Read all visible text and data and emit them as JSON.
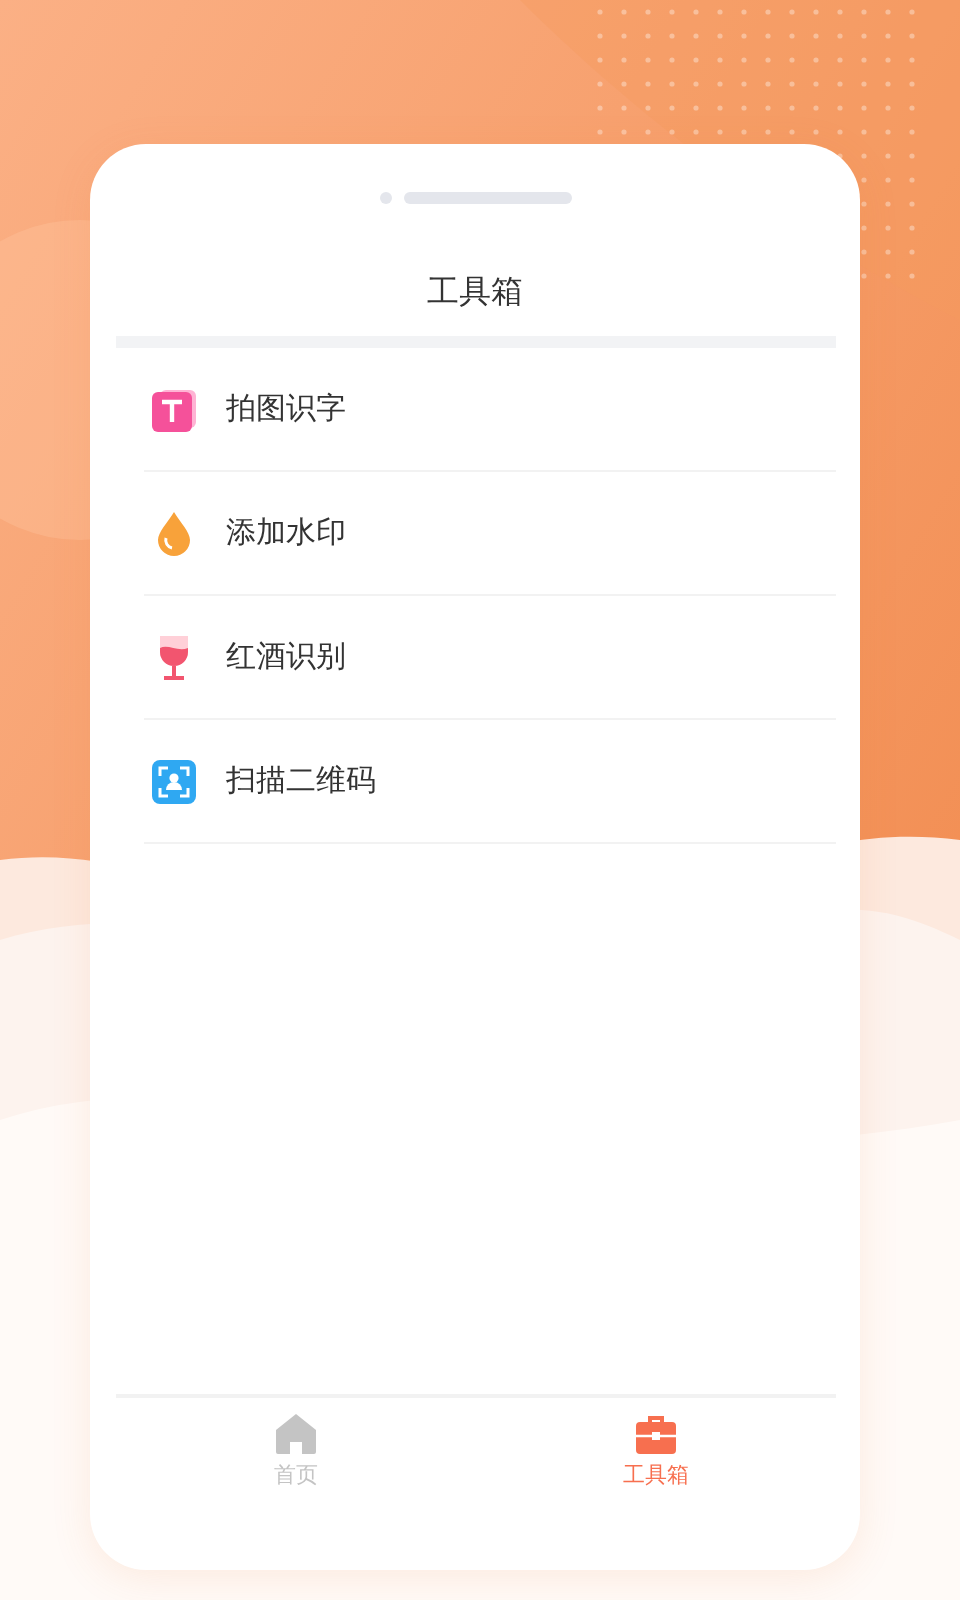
{
  "title": "工具箱",
  "tools": [
    {
      "kind": "text",
      "label": "拍图识字"
    },
    {
      "kind": "drop",
      "label": "添加水印"
    },
    {
      "kind": "wine",
      "label": "红酒识别"
    },
    {
      "kind": "scan",
      "label": "扫描二维码"
    }
  ],
  "tabs": [
    {
      "kind": "home",
      "label": "首页",
      "selected": false
    },
    {
      "kind": "toolbox",
      "label": "工具箱",
      "selected": true
    }
  ]
}
